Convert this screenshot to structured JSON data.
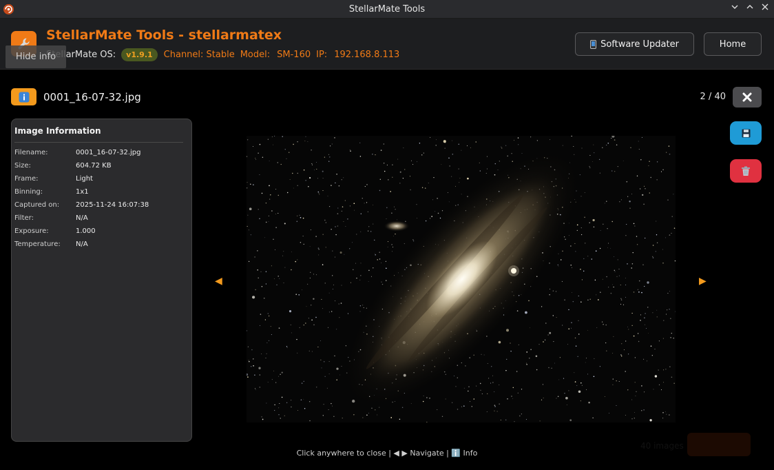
{
  "window": {
    "title": "StellarMate Tools",
    "icons": {
      "app": "app-logo-icon",
      "minimize": "chevron-down-icon",
      "maximize": "chevron-up-icon",
      "close": "close-icon"
    }
  },
  "header": {
    "title": "StellarMate Tools - stellarmatex",
    "os_label": "StellarMate OS:",
    "version": "v1.9.1",
    "channel": "Channel: Stable",
    "model_label": "Model:",
    "model": "SM-160",
    "ip_label": "IP:",
    "ip": "192.168.8.113",
    "hide_info_label": "Hide info",
    "software_updater_label": "Software Updater",
    "home_label": "Home",
    "logo_icon": "wrench-icon",
    "updater_icon": "phone-icon"
  },
  "viewer": {
    "filename": "0001_16-07-32.jpg",
    "counter": "2 / 40",
    "info_icon": "info-icon",
    "close_icon": "close-x-icon",
    "save_icon": "floppy-disk-icon",
    "delete_icon": "trash-icon",
    "prev_label": "◀",
    "next_label": "▶",
    "hint": "Click anywhere to close | ◀ ▶ Navigate | ℹ️ Info",
    "background_count": "40 images"
  },
  "info_panel": {
    "title": "Image Information",
    "rows": [
      {
        "key": "Filename:",
        "value": "0001_16-07-32.jpg"
      },
      {
        "key": "Size:",
        "value": "604.72 KB"
      },
      {
        "key": "Frame:",
        "value": "Light"
      },
      {
        "key": "Binning:",
        "value": "1x1"
      },
      {
        "key": "Captured on:",
        "value": "2025-11-24 16:07:38"
      },
      {
        "key": "Filter:",
        "value": "N/A"
      },
      {
        "key": "Exposure:",
        "value": "1.000"
      },
      {
        "key": "Temperature:",
        "value": "N/A"
      }
    ]
  },
  "colors": {
    "accent": "#f07a16",
    "save": "#1f9bd6",
    "delete": "#e03140",
    "panel": "#2b2b2d"
  }
}
